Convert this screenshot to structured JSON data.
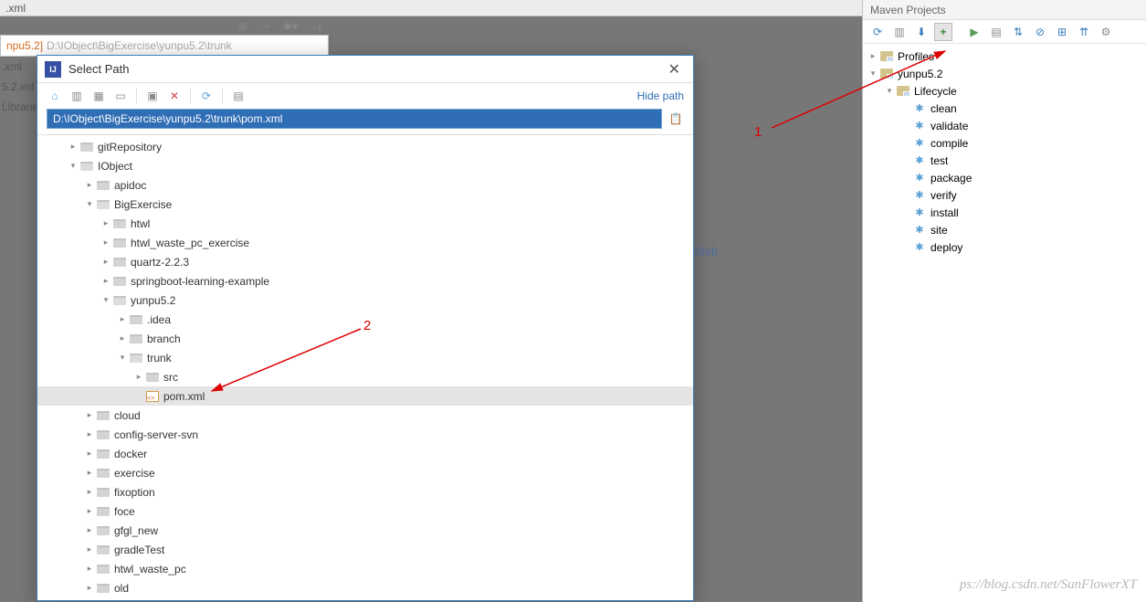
{
  "editor": {
    "tab_top": ".xml",
    "tab_name": "npu5.2]",
    "tab_path": "D:\\IObject\\BigExercise\\yunpu5.2\\trunk"
  },
  "left_files": {
    "f1": ".xml",
    "f2": "5.2.iml",
    "f3": "Librarie"
  },
  "hint": "Shift",
  "watermark": "ps://blog.csdn.net/SunFlowerXT",
  "annotations": {
    "one": "1",
    "two": "2"
  },
  "dialog": {
    "title": "Select Path",
    "hide_path": "Hide path",
    "path_value": "D:\\IObject\\BigExercise\\yunpu5.2\\trunk\\pom.xml",
    "tree": {
      "gitrepo": "gitRepository",
      "iobject": "IObject",
      "apidoc": "apidoc",
      "bigex": "BigExercise",
      "htwl": "htwl",
      "htwl_waste": "htwl_waste_pc_exercise",
      "quartz": "quartz-2.2.3",
      "springboot": "springboot-learning-example",
      "yunpu": "yunpu5.2",
      "idea": ".idea",
      "branch": "branch",
      "trunk": "trunk",
      "src": "src",
      "pom": "pom.xml",
      "cloud": "cloud",
      "config": "config-server-svn",
      "docker": "docker",
      "exercise": "exercise",
      "fixoption": "fixoption",
      "foce": "foce",
      "gfgl": "gfgl_new",
      "gradle": "gradleTest",
      "htwl_pc": "htwl_waste_pc",
      "old": "old"
    }
  },
  "maven": {
    "title": "Maven Projects",
    "profiles": "Profiles",
    "project": "yunpu5.2",
    "lifecycle": "Lifecycle",
    "goals": {
      "clean": "clean",
      "validate": "validate",
      "compile": "compile",
      "test": "test",
      "package": "package",
      "verify": "verify",
      "install": "install",
      "site": "site",
      "deploy": "deploy"
    }
  }
}
